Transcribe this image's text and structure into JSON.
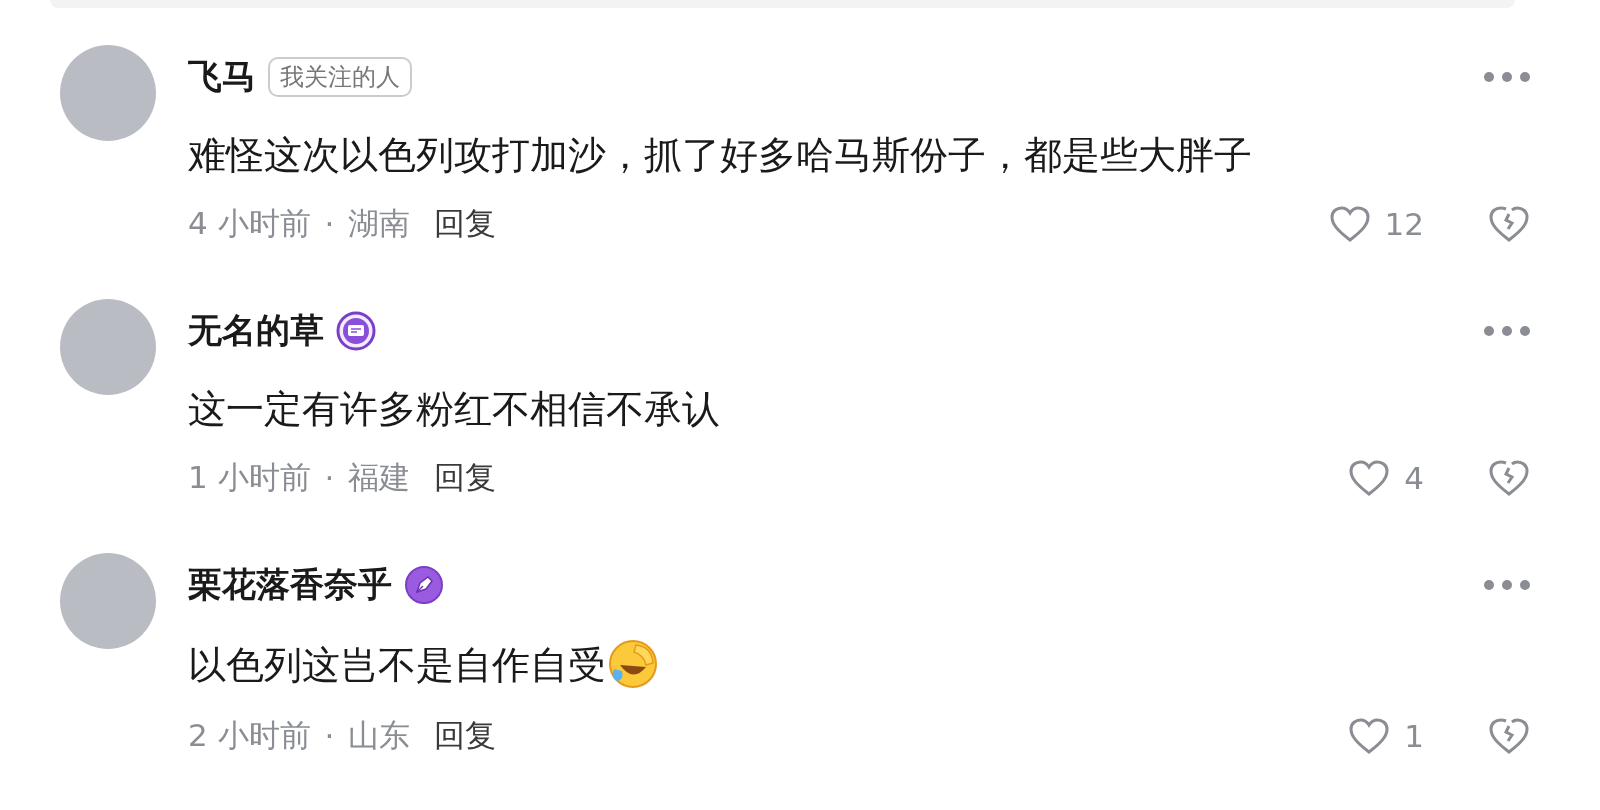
{
  "comments": [
    {
      "name": "飞马",
      "badge": {
        "kind": "tag",
        "label": "我关注的人"
      },
      "text": "难怪这次以色列攻打加沙，抓了好多哈马斯份子，都是些大胖子",
      "emoji": false,
      "time": "4 小时前",
      "separator": "·",
      "region": "湖南",
      "reply": "回复",
      "likes": "12"
    },
    {
      "name": "无名的草",
      "badge": {
        "kind": "chat"
      },
      "text": "这一定有许多粉红不相信不承认",
      "emoji": false,
      "time": "1 小时前",
      "separator": "·",
      "region": "福建",
      "reply": "回复",
      "likes": "4"
    },
    {
      "name": "栗花落香奈乎",
      "badge": {
        "kind": "pen"
      },
      "text": "以色列这岂不是自作自受",
      "emoji": true,
      "time": "2 小时前",
      "separator": "·",
      "region": "山东",
      "reply": "回复",
      "likes": "1"
    }
  ]
}
